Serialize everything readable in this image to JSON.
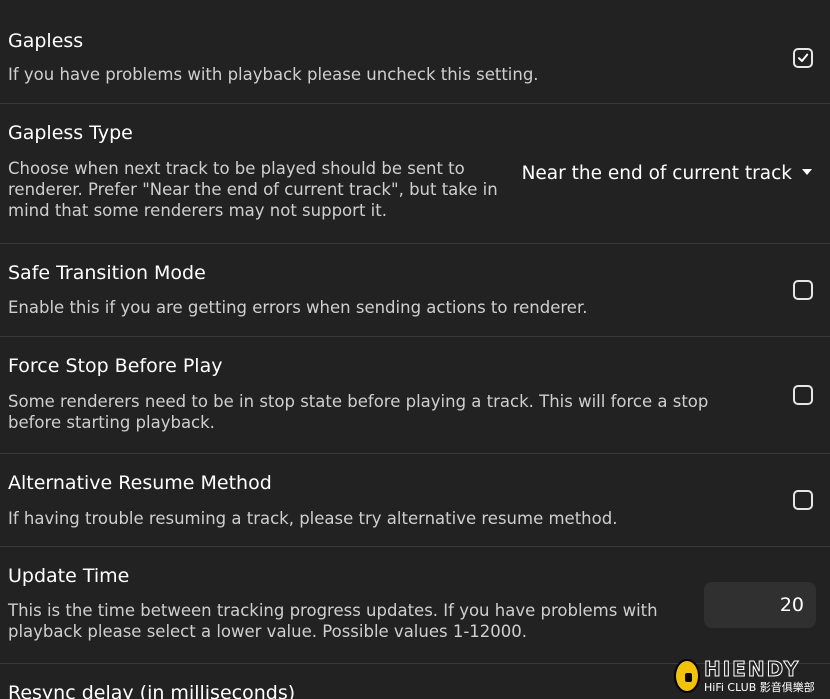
{
  "settings": [
    {
      "title": "Gapless",
      "description": "If you have problems with playback please uncheck this setting.",
      "control": "checkbox",
      "checked": true
    },
    {
      "title": "Gapless Type",
      "description": "Choose when next track to be played should be sent to renderer. Prefer \"Near the end of current track\", but take in mind that some renderers may not support it.",
      "control": "select",
      "selected_value": "Near the end of current track"
    },
    {
      "title": "Safe Transition Mode",
      "description": "Enable this if you are getting errors when sending actions to renderer.",
      "control": "checkbox",
      "checked": false
    },
    {
      "title": "Force Stop Before Play",
      "description": "Some renderers need to be in stop state before playing a track. This will force a stop before starting playback.",
      "control": "checkbox",
      "checked": false
    },
    {
      "title": "Alternative Resume Method",
      "description": "If having trouble resuming a track, please try alternative resume method.",
      "control": "checkbox",
      "checked": false
    },
    {
      "title": "Update Time",
      "description": "This is the time between tracking progress updates. If you have problems with playback please select a lower value. Possible values 1-12000.",
      "control": "number",
      "value": "20"
    },
    {
      "title": "Resync delay (in milliseconds)",
      "description": "",
      "control": "none"
    }
  ],
  "watermark": {
    "brand": "HIENDY",
    "subtitle": "HiFi CLUB 影音俱樂部"
  },
  "colors": {
    "background": "#222222",
    "divider": "#3a3a3a",
    "input_background": "#303030"
  },
  "icons": {
    "checkmark": "check-icon",
    "dropdown": "caret-down-icon"
  }
}
